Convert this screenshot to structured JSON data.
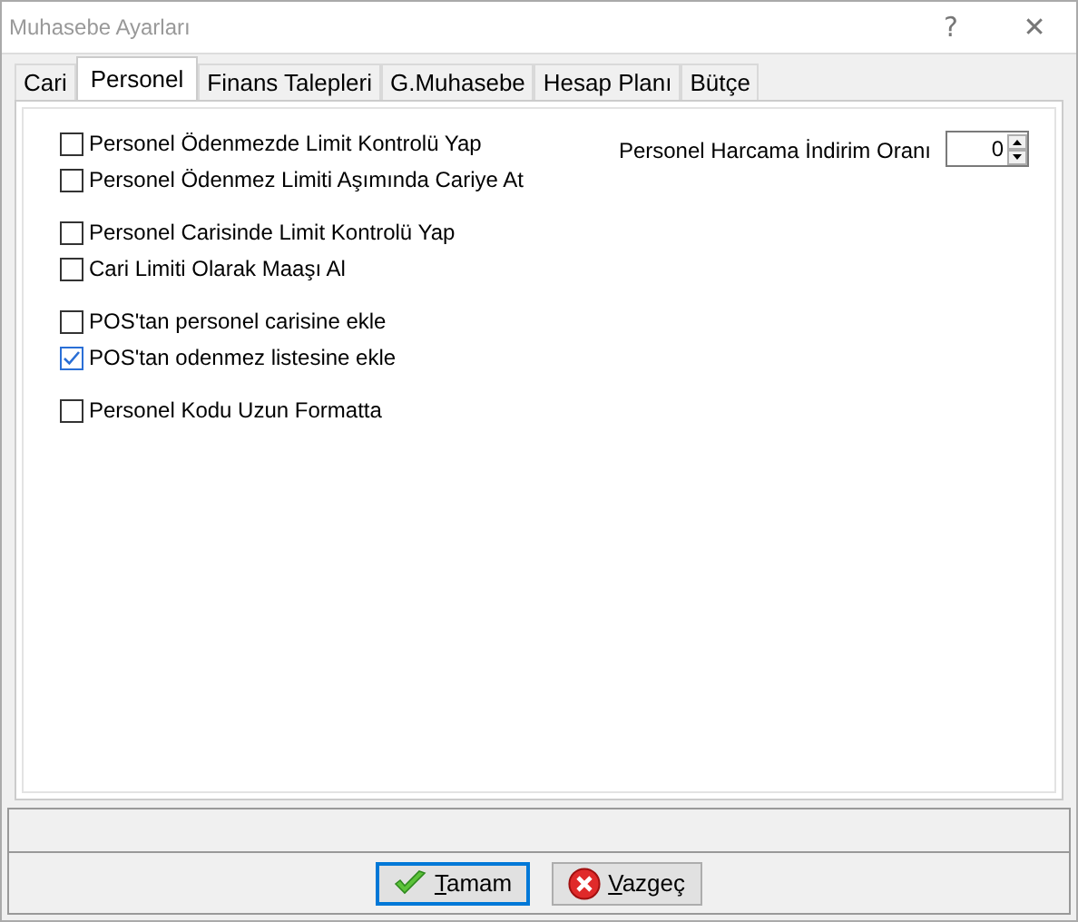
{
  "window": {
    "title": "Muhasebe Ayarları",
    "help": "?",
    "close": "✕"
  },
  "tabs": [
    {
      "label": "Cari",
      "selected": false
    },
    {
      "label": "Personel",
      "selected": true
    },
    {
      "label": "Finans Talepleri",
      "selected": false
    },
    {
      "label": "G.Muhasebe",
      "selected": false
    },
    {
      "label": "Hesap Planı",
      "selected": false
    },
    {
      "label": "Bütçe",
      "selected": false
    }
  ],
  "option_groups": [
    [
      {
        "label": "Personel Ödenmezde Limit Kontrolü Yap",
        "checked": false
      },
      {
        "label": "Personel Ödenmez Limiti Aşımında Cariye At",
        "checked": false
      }
    ],
    [
      {
        "label": "Personel Carisinde Limit Kontrolü Yap",
        "checked": false
      },
      {
        "label": "Cari Limiti Olarak Maaşı Al",
        "checked": false
      }
    ],
    [
      {
        "label": "POS'tan personel carisine ekle",
        "checked": false
      },
      {
        "label": "POS'tan odenmez listesine ekle",
        "checked": true
      }
    ],
    [
      {
        "label": "Personel Kodu Uzun Formatta",
        "checked": false
      }
    ]
  ],
  "discount_rate": {
    "label": "Personel Harcama İndirim Oranı",
    "value": "0"
  },
  "buttons": [
    {
      "label": "Tamam",
      "kind": "ok",
      "default": true
    },
    {
      "label": "Vazgeç",
      "kind": "cancel",
      "default": false
    }
  ]
}
